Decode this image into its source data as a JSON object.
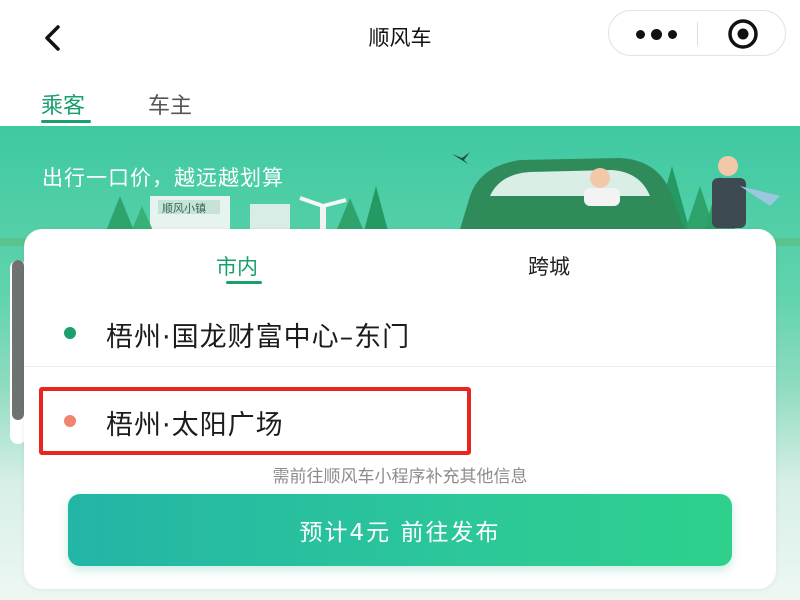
{
  "nav": {
    "title": "顺风车",
    "back_icon": "chevron-left-icon",
    "more_icon": "more-dots-icon",
    "close_icon": "target-circle-icon"
  },
  "role_tabs": [
    {
      "label": "乘客",
      "active": true
    },
    {
      "label": "车主",
      "active": false
    }
  ],
  "banner": {
    "slogan": "出行一口价，越远越划算",
    "sign_text": "顺风小镇"
  },
  "card": {
    "tabs": [
      {
        "label": "市内",
        "active": true
      },
      {
        "label": "跨城",
        "active": false
      }
    ],
    "origin": "梧州·国龙财富中心–东门",
    "destination": "梧州·太阳广场",
    "hint": "需前往顺风车小程序补充其他信息",
    "publish_button": "预计4元 前往发布"
  },
  "colors": {
    "accent": "#1aa06d",
    "origin_dot": "#1aa06d",
    "destination_dot": "#f0846f",
    "highlight_border": "#e8251e"
  }
}
